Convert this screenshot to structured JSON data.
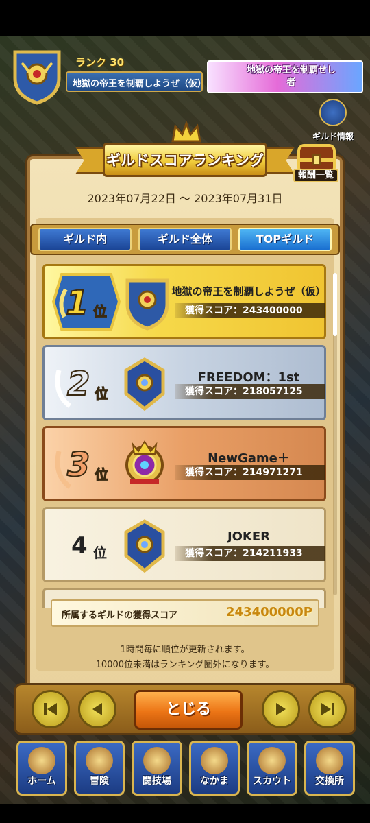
{
  "header": {
    "rank_label": "ランク 30",
    "guild_name": "地獄の帝王を制覇しようぜ（仮）",
    "title_badge": "地獄の帝王を制覇せし者",
    "guild_info_label": "ギルド情報"
  },
  "panel": {
    "title": "ギルドスコアランキング",
    "reward_label": "報酬一覧",
    "period": "2023年07月22日 ～ 2023年07月31日",
    "tabs": [
      {
        "label": "ギルド内",
        "active": false
      },
      {
        "label": "ギルド全体",
        "active": false
      },
      {
        "label": "TOPギルド",
        "active": true
      }
    ],
    "score_prefix": "獲得スコア：",
    "rank_suffix": "位",
    "rows": [
      {
        "rank": "1",
        "name": "地獄の帝王を制覇しようぜ（仮）",
        "score": "獲得スコア：243400000"
      },
      {
        "rank": "2",
        "name": "FREEDOM：1st",
        "score": "獲得スコア：218057125"
      },
      {
        "rank": "3",
        "name": "NewGame＋",
        "score": "獲得スコア：214971271"
      },
      {
        "rank": "4",
        "name": "JOKER",
        "score": "獲得スコア：214211933"
      }
    ],
    "summary_label": "所属するギルドの獲得スコア",
    "summary_value": "243400000P",
    "note1": "1時間毎に順位が更新されます。",
    "note2": "10000位未満はランキング圏外になります。",
    "close_label": "とじる"
  },
  "bottom_nav": [
    {
      "label": "ホーム",
      "icon": "home-icon"
    },
    {
      "label": "冒険",
      "icon": "adventure-icon"
    },
    {
      "label": "闘技場",
      "icon": "arena-icon"
    },
    {
      "label": "なかま",
      "icon": "party-icon"
    },
    {
      "label": "スカウト",
      "icon": "scout-icon"
    },
    {
      "label": "交換所",
      "icon": "exchange-icon"
    }
  ],
  "colors": {
    "gold": "#f1cd3c",
    "silver": "#c7d3e2",
    "bronze": "#e99f66",
    "tab_active": "#1a6fd0",
    "close_button": "#ec7516"
  }
}
